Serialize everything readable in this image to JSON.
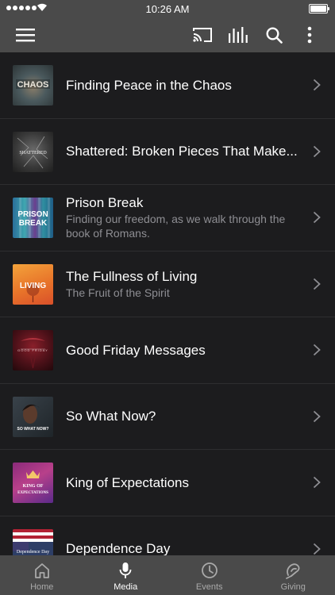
{
  "status_bar": {
    "time": "10:26 AM"
  },
  "navbar": {
    "icons": [
      "menu-icon",
      "cast-icon",
      "equalizer-icon",
      "search-icon",
      "more-vertical-icon"
    ]
  },
  "series": [
    {
      "title": "Finding Peace in the Chaos",
      "subtitle": "",
      "thumb_text": "CHAOS"
    },
    {
      "title": "Shattered: Broken Pieces That Make...",
      "subtitle": "",
      "thumb_text": "SHATTERED"
    },
    {
      "title": "Prison Break",
      "subtitle": "Finding our freedom, as we walk through the book of Romans.",
      "thumb_text": "PRISON BREAK"
    },
    {
      "title": "The Fullness of Living",
      "subtitle": "The Fruit of the Spirit",
      "thumb_text": "LIVING"
    },
    {
      "title": "Good Friday Messages",
      "subtitle": "",
      "thumb_text": "GOOD FRIDAY"
    },
    {
      "title": "So What Now?",
      "subtitle": "",
      "thumb_text": "SO WHAT NOW?"
    },
    {
      "title": "King of Expectations",
      "subtitle": "",
      "thumb_text": "KING OF EXPECTATIONS"
    },
    {
      "title": "Dependence Day",
      "subtitle": "",
      "thumb_text": "Dependence Day"
    }
  ],
  "tabbar": {
    "tabs": [
      {
        "label": "Home",
        "icon": "home-icon",
        "active": false
      },
      {
        "label": "Media",
        "icon": "microphone-icon",
        "active": true
      },
      {
        "label": "Events",
        "icon": "clock-icon",
        "active": false
      },
      {
        "label": "Giving",
        "icon": "giving-icon",
        "active": false
      }
    ]
  },
  "colors": {
    "bar": "#4a4a4a",
    "background": "#1c1c1e",
    "subtitle": "#8e8e93"
  }
}
